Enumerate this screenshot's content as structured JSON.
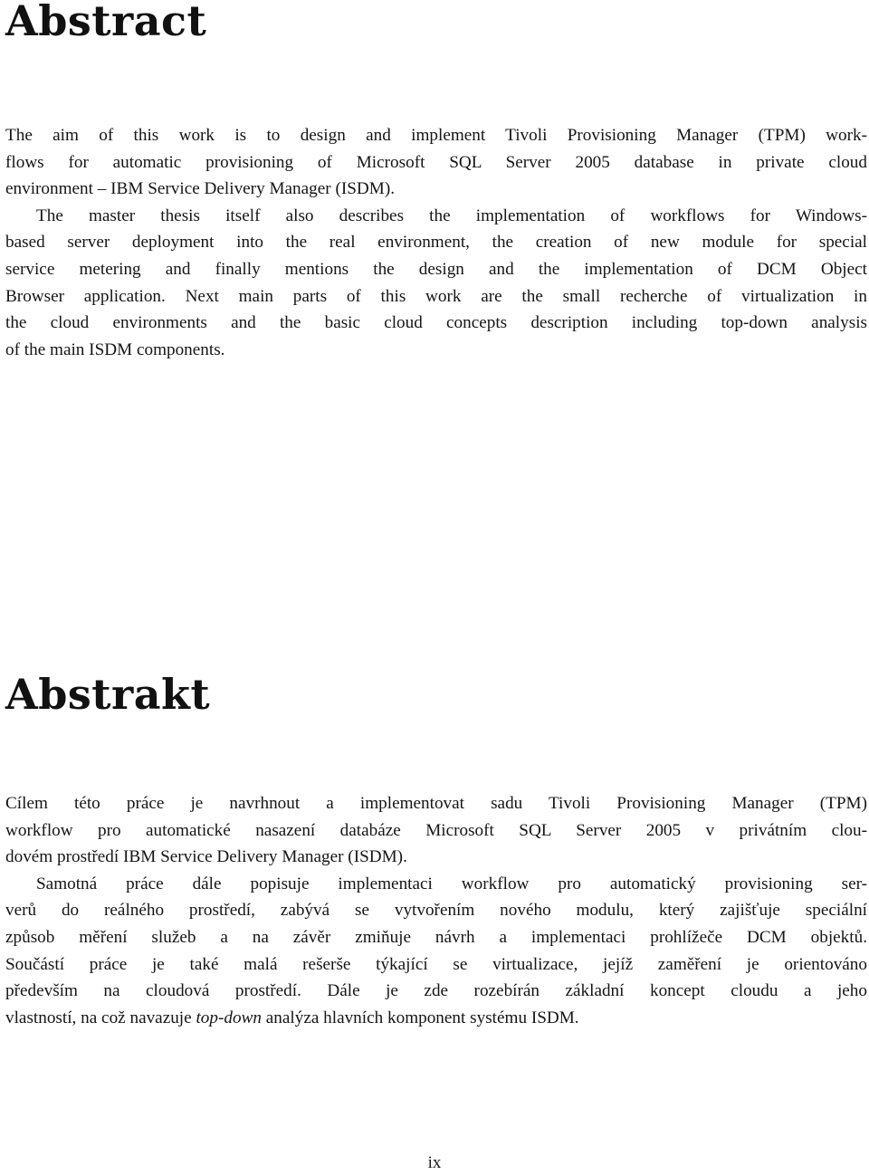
{
  "abstract_en": {
    "title": "Abstract",
    "paragraphs": [
      {
        "lines": [
          "The aim of this work is to design and implement Tivoli Provisioning Manager (TPM) work-",
          "flows for automatic provisioning of Microsoft SQL Server 2005 database in private cloud",
          "environment – IBM Service Delivery Manager (ISDM)."
        ]
      },
      {
        "lines": [
          "The master thesis itself also describes the implementation of workflows for Windows-",
          "based server deployment into the real environment, the creation of new module for special",
          "service metering and finally mentions the design and the implementation of DCM Object",
          "Browser application. Next main parts of this work are the small recherche of virtualization in",
          "the cloud environments and the basic cloud concepts description including top-down analysis",
          "of the main ISDM components."
        ]
      }
    ]
  },
  "abstract_cz": {
    "title": "Abstrakt",
    "paragraphs": [
      {
        "lines": [
          "Cílem této práce je navrhnout a implementovat sadu Tivoli Provisioning Manager (TPM)",
          "workflow pro automatické nasazení databáze Microsoft SQL Server 2005 v privátním clou-",
          "dovém prostředí IBM Service Delivery Manager (ISDM)."
        ]
      },
      {
        "lines": [
          "Samotná práce dále popisuje implementaci workflow pro automatický provisioning ser-",
          "verů do reálného prostředí, zabývá se vytvořením nového modulu, který zajišťuje speciální",
          "způsob měření služeb a na závěr zmiňuje návrh a implementaci prohlížeče DCM objektů.",
          "Součástí práce je také malá rešerše týkající se virtualizace, jejíž zaměření je orientováno",
          "především na cloudová prostředí. Dále je zde rozebírán základní koncept cloudu a jeho"
        ],
        "last_line": {
          "before": "vlastností, na což navazuje ",
          "italic": "top-down",
          "after": " analýza hlavních komponent systému ISDM."
        }
      }
    ]
  },
  "page_number": "ix"
}
